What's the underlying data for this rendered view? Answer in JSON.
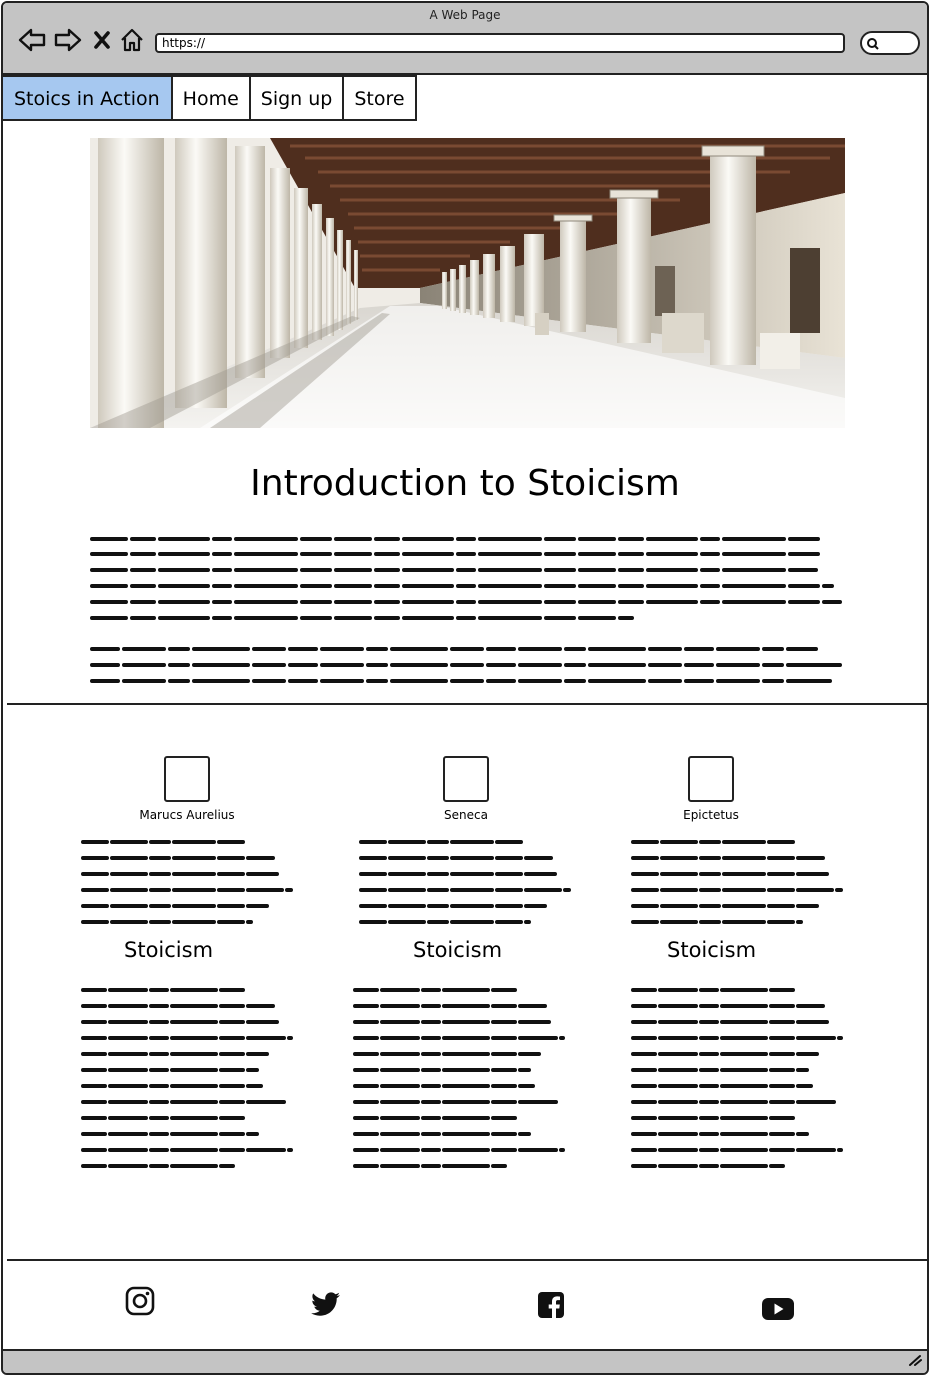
{
  "window": {
    "title": "A Web Page"
  },
  "address_bar": {
    "url": "https://"
  },
  "nav": {
    "items": [
      {
        "label": "Stoics in Action",
        "active": true
      },
      {
        "label": "Home",
        "active": false
      },
      {
        "label": "Sign up",
        "active": false
      },
      {
        "label": "Store",
        "active": false
      }
    ]
  },
  "hero": {
    "image": "stoa-colonnade-photo"
  },
  "intro": {
    "title": "Introduction to Stoicism"
  },
  "philosophers": [
    {
      "name": "Marucs Aurelius"
    },
    {
      "name": "Seneca"
    },
    {
      "name": "Epictetus"
    }
  ],
  "columns": [
    {
      "heading": "Stoicism"
    },
    {
      "heading": "Stoicism"
    },
    {
      "heading": "Stoicism"
    }
  ],
  "footer": {
    "social": [
      "instagram-icon",
      "twitter-icon",
      "facebook-icon",
      "youtube-icon"
    ]
  },
  "colors": {
    "active_tab": "#a6c8f0",
    "chrome": "#c4c4c4",
    "ink": "#111111"
  }
}
